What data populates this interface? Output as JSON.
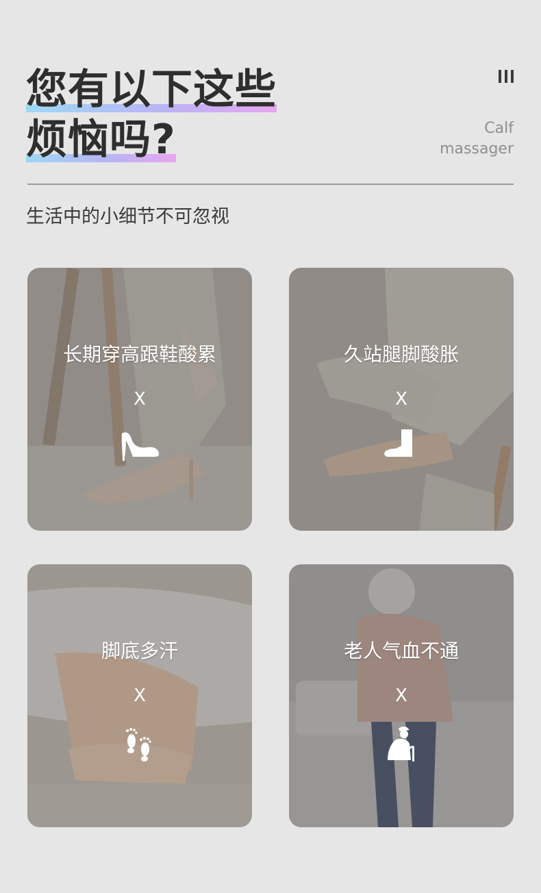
{
  "header": {
    "title_line1": "您有以下这些",
    "title_line2": "烦恼吗?",
    "side_label_line1": "Calf",
    "side_label_line2": "massager",
    "menu_icon": "three-bars-icon"
  },
  "subtitle": "生活中的小细节不可忽视",
  "cards": [
    {
      "label": "长期穿高跟鞋酸累",
      "mark": "X",
      "icon": "high-heel-icon"
    },
    {
      "label": "久站腿脚酸胀",
      "mark": "X",
      "icon": "boot-icon"
    },
    {
      "label": "脚底多汗",
      "mark": "X",
      "icon": "footprints-icon"
    },
    {
      "label": "老人气血不通",
      "mark": "X",
      "icon": "elderly-with-cane-icon"
    }
  ],
  "colors": {
    "background": "#e6e6e6",
    "title": "#2e2e2e",
    "highlight_start": "#9fd8f5",
    "highlight_end": "#e9a6ef"
  }
}
